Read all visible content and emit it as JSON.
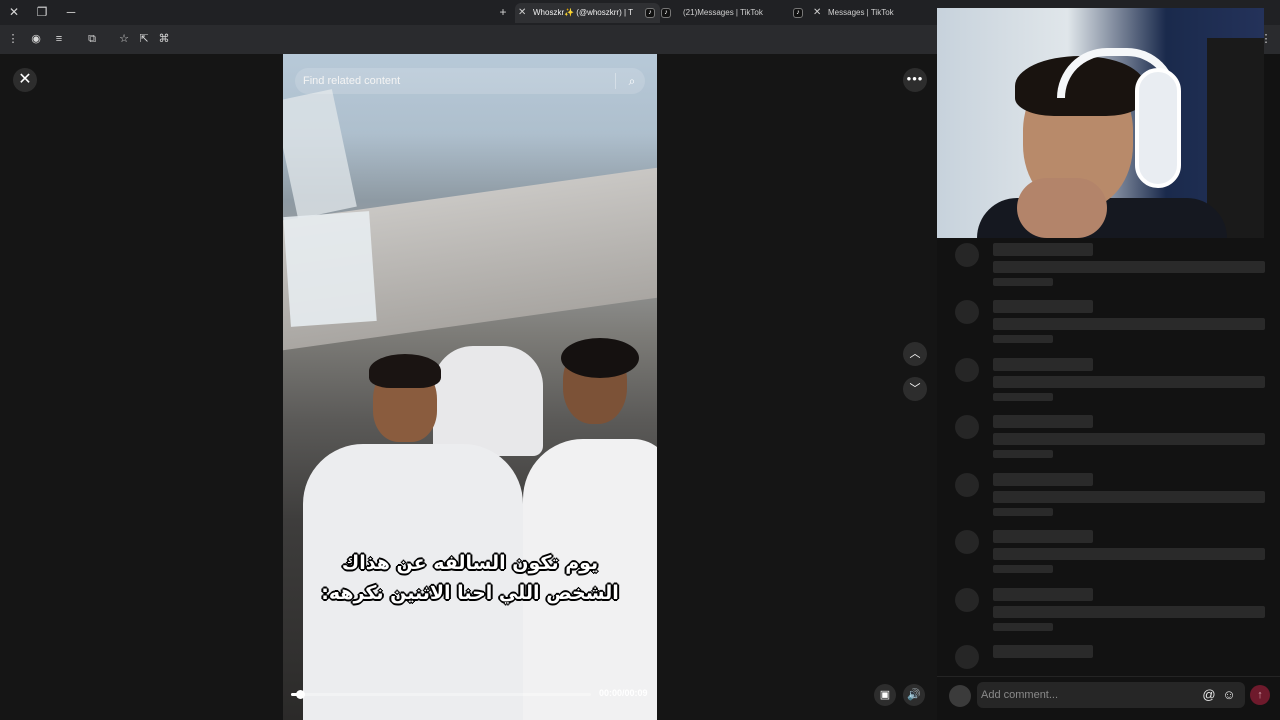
{
  "browser": {
    "tabs": [
      {
        "label": "Whoszkr✨ (@whoszkrr) | T",
        "active": true
      },
      {
        "label": "(21)Messages | TikTok",
        "active": false
      },
      {
        "label": "Messages | TikTok",
        "active": false
      }
    ],
    "new_tab_symbol": "+",
    "tab_close_symbol": "✕"
  },
  "viewer": {
    "close_symbol": "✕",
    "more_symbol": "•••",
    "prev_symbol": "︿",
    "next_symbol": "﹀",
    "search": {
      "placeholder": "Find related content"
    },
    "caption_line1": "يوم تكون السالفه عن هذاك",
    "caption_line2": "الشخص اللي احنا الاثنين نكرهه:",
    "time": "00:00/00:09",
    "progress_fraction": 0.03,
    "volume_symbol": "🔊",
    "miniplayer_symbol": "▣"
  },
  "comments": {
    "input_placeholder": "Add comment...",
    "at_symbol": "@",
    "emoji_symbol": "☺",
    "send_symbol": "↑"
  },
  "icons": [
    "close-icon",
    "more-icon",
    "chevron-up-icon",
    "chevron-down-icon",
    "search-icon",
    "volume-icon",
    "miniplayer-icon",
    "mention-icon",
    "emoji-icon",
    "send-icon"
  ],
  "colors": {
    "send_button": "#6e1a2c",
    "background": "#121212"
  }
}
